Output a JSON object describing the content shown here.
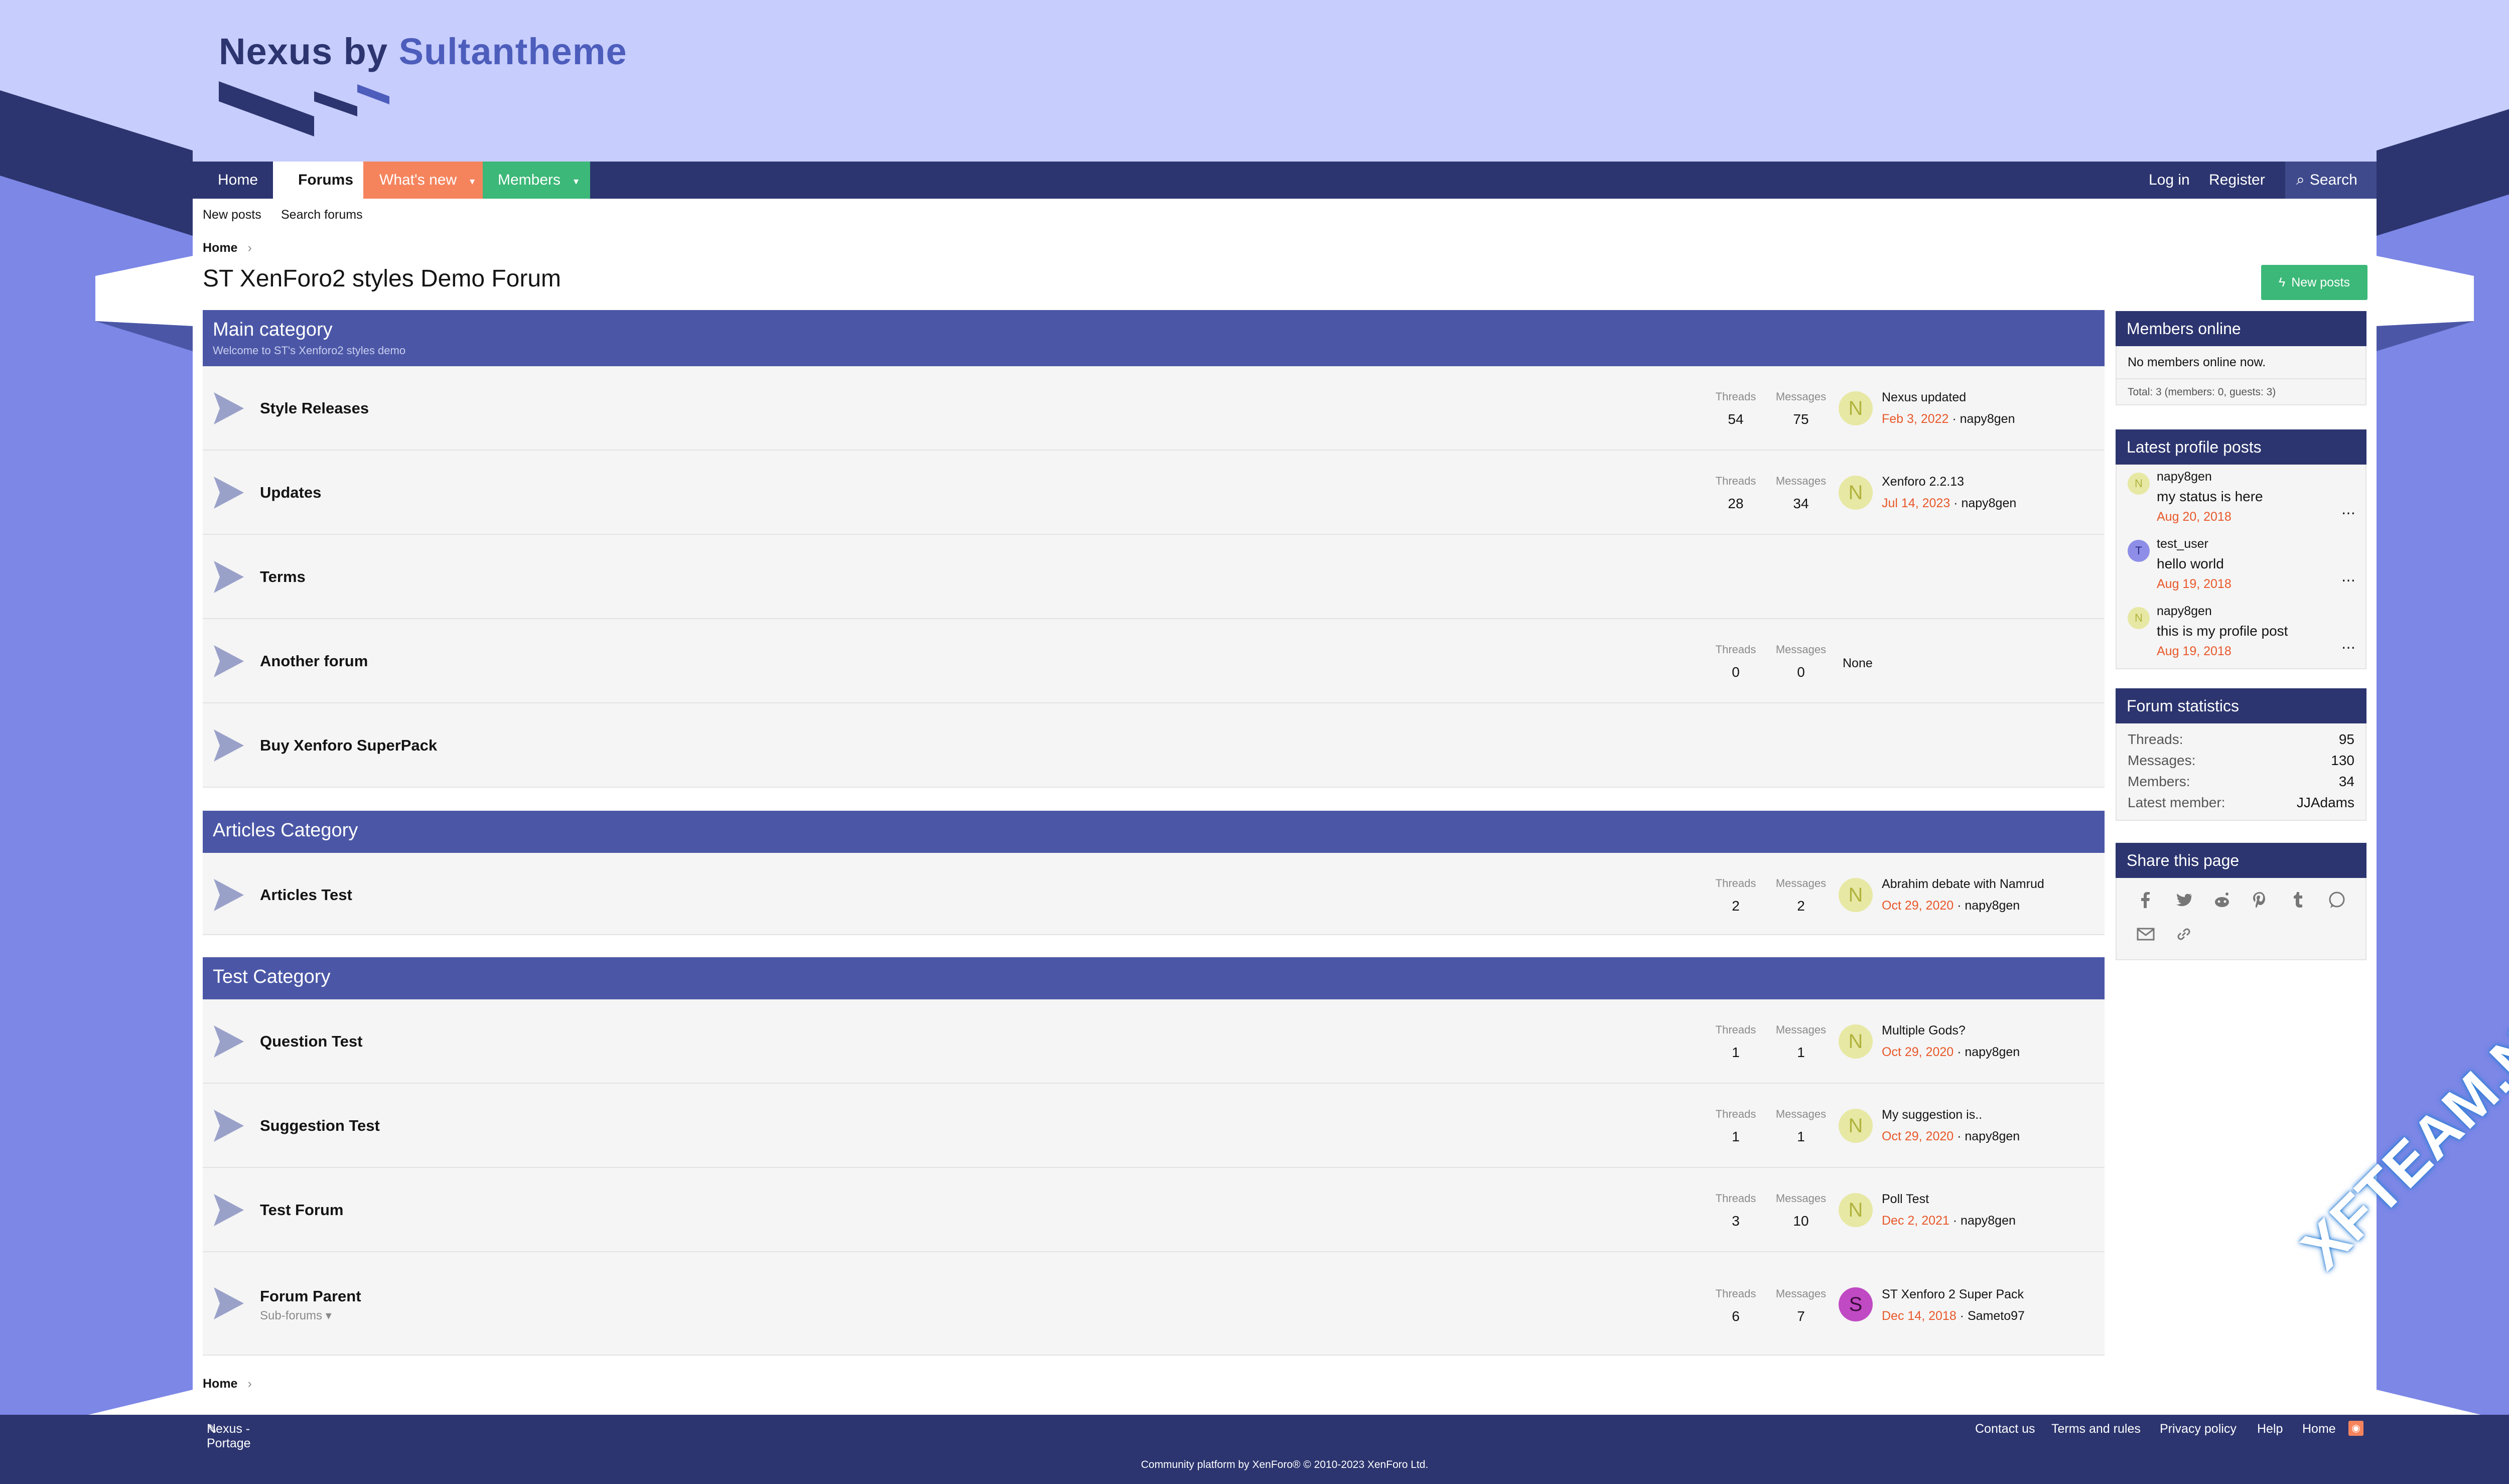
{
  "logo": {
    "part1": "Nexus by ",
    "part2": "Sultantheme"
  },
  "nav": {
    "tabs": [
      {
        "label": "Home"
      },
      {
        "label": "Forums"
      },
      {
        "label": "What's new"
      },
      {
        "label": "Members"
      }
    ],
    "right": {
      "login": "Log in",
      "register": "Register",
      "search": "Search"
    },
    "sub": {
      "new_posts": "New posts",
      "search_forums": "Search forums"
    }
  },
  "breadcrumb": {
    "home": "Home",
    "home_bottom": "Home"
  },
  "page": {
    "title": "ST XenForo2 styles Demo Forum",
    "new_posts_button": "New posts"
  },
  "stat_labels": {
    "threads": "Threads",
    "messages": "Messages"
  },
  "categories": [
    {
      "title": "Main category",
      "description": "Welcome to ST's Xenforo2 styles demo",
      "nodes": [
        {
          "name": "Style Releases",
          "threads": "54",
          "messages": "75",
          "avatar": "N",
          "last_title": "Nexus updated",
          "last_date": "Feb 3, 2022",
          "last_user": "napy8gen"
        },
        {
          "name": "Updates",
          "threads": "28",
          "messages": "34",
          "avatar": "N",
          "last_title": "Xenforo 2.2.13",
          "last_date": "Jul 14, 2023",
          "last_user": "napy8gen"
        },
        {
          "name": "Terms"
        },
        {
          "name": "Another forum",
          "threads": "0",
          "messages": "0",
          "none": "None"
        },
        {
          "name": "Buy Xenforo SuperPack"
        }
      ]
    },
    {
      "title": "Articles Category",
      "nodes": [
        {
          "name": "Articles Test",
          "threads": "2",
          "messages": "2",
          "avatar": "N",
          "last_title": "Abrahim debate with Namrud",
          "last_date": "Oct 29, 2020",
          "last_user": "napy8gen"
        }
      ]
    },
    {
      "title": "Test Category",
      "nodes": [
        {
          "name": "Question Test",
          "threads": "1",
          "messages": "1",
          "avatar": "N",
          "last_title": "Multiple Gods?",
          "last_date": "Oct 29, 2020",
          "last_user": "napy8gen"
        },
        {
          "name": "Suggestion Test",
          "threads": "1",
          "messages": "1",
          "avatar": "N",
          "last_title": "My suggestion is..",
          "last_date": "Oct 29, 2020",
          "last_user": "napy8gen"
        },
        {
          "name": "Test Forum",
          "threads": "3",
          "messages": "10",
          "avatar": "N",
          "last_title": "Poll Test",
          "last_date": "Dec 2, 2021",
          "last_user": "napy8gen"
        },
        {
          "name": "Forum Parent",
          "sub": "Sub-forums",
          "threads": "6",
          "messages": "7",
          "avatar": "S",
          "last_title": "ST Xenforo 2 Super Pack",
          "last_date": "Dec 14, 2018",
          "last_user": "Sameto97"
        }
      ]
    }
  ],
  "sidebar": {
    "members_online": {
      "title": "Members online",
      "text": "No members online now.",
      "total": "Total: 3 (members: 0, guests: 3)"
    },
    "profile_posts": {
      "title": "Latest profile posts",
      "items": [
        {
          "avatar": "N",
          "user": "napy8gen",
          "status": "my status is here",
          "date": "Aug 20, 2018"
        },
        {
          "avatar": "T",
          "user": "test_user",
          "status": "hello world",
          "date": "Aug 19, 2018"
        },
        {
          "avatar": "N",
          "user": "napy8gen",
          "status": "this is my profile post",
          "date": "Aug 19, 2018"
        }
      ]
    },
    "forum_stats": {
      "title": "Forum statistics",
      "rows": [
        {
          "k": "Threads:",
          "v": "95"
        },
        {
          "k": "Messages:",
          "v": "130"
        },
        {
          "k": "Members:",
          "v": "34"
        },
        {
          "k": "Latest member:",
          "v": "JJAdams"
        }
      ]
    },
    "share": {
      "title": "Share this page",
      "icons": [
        "facebook-icon",
        "twitter-icon",
        "reddit-icon",
        "pinterest-icon",
        "tumblr-icon",
        "whatsapp-icon",
        "email-icon",
        "link-icon"
      ]
    }
  },
  "footer": {
    "style": "Nexus - Portage",
    "links": [
      "Contact us",
      "Terms and rules",
      "Privacy policy",
      "Help",
      "Home"
    ],
    "copyright": "Community platform by XenForo® © 2010-2023 XenForo Ltd."
  },
  "watermark": "XFTEAM.NET",
  "colors": {
    "nav": "#2c356f",
    "category": "#4b57a6",
    "whats_new": "#f5845d",
    "members": "#3cb878",
    "date": "#e8582a"
  }
}
